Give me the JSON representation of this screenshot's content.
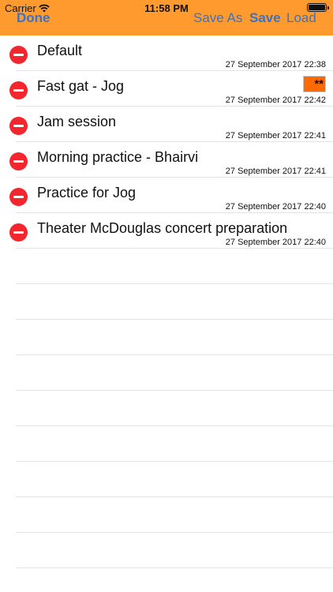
{
  "status_bar": {
    "carrier": "Carrier",
    "time": "11:58 PM"
  },
  "nav": {
    "done_label": "Done",
    "save_as_label": "Save As",
    "save_label": "Save",
    "load_label": "Load"
  },
  "colors": {
    "header_bg": "#ff9a2f",
    "nav_text": "#3a73c4",
    "delete_red": "#f2262c",
    "badge_orange": "#ff6a00"
  },
  "sessions": [
    {
      "title": "Default",
      "date": "27 September 2017 22:38",
      "badge": ""
    },
    {
      "title": "Fast gat - Jog",
      "date": "27 September 2017 22:42",
      "badge": "**"
    },
    {
      "title": "Jam session",
      "date": "27 September 2017 22:41",
      "badge": ""
    },
    {
      "title": "Morning practice - Bhairvi",
      "date": "27 September 2017 22:41",
      "badge": ""
    },
    {
      "title": "Practice for Jog",
      "date": "27 September 2017 22:40",
      "badge": ""
    },
    {
      "title": "Theater McDouglas concert preparation",
      "date": "27 September 2017 22:40",
      "badge": ""
    }
  ]
}
